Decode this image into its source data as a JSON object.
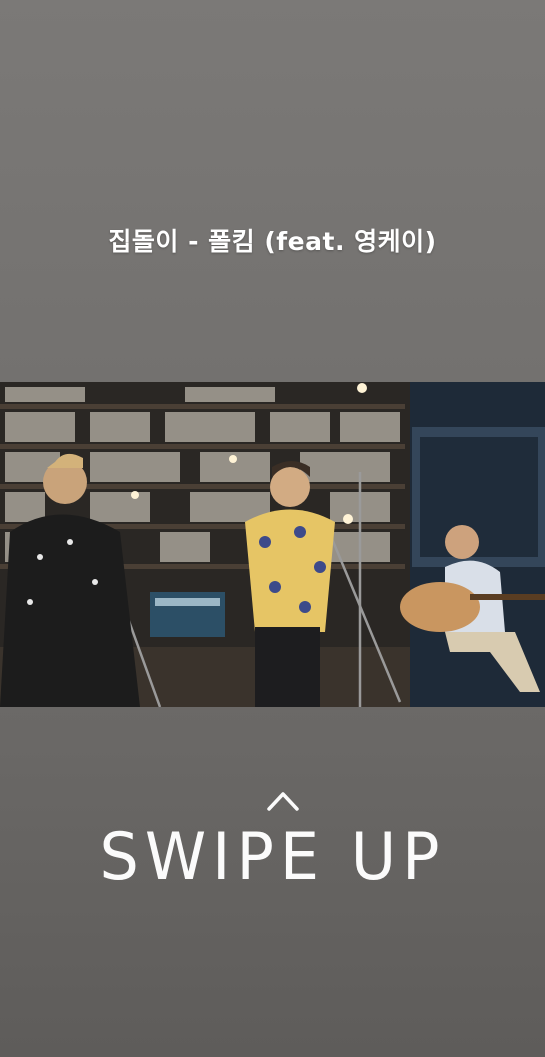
{
  "story": {
    "title": "집돌이 - 폴킴 (feat. 영케이)",
    "swipe_label": "SWIPE UP",
    "swipe_icon": "chevron-up-icon"
  }
}
